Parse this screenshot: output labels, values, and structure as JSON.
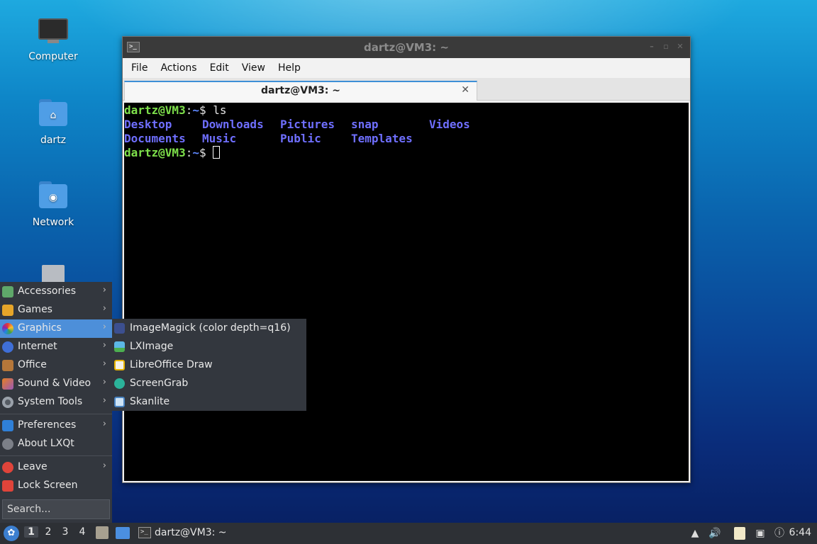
{
  "desktop": {
    "icons": [
      {
        "label": "Computer"
      },
      {
        "label": "dartz"
      },
      {
        "label": "Network"
      }
    ]
  },
  "terminal": {
    "window_title": "dartz@VM3: ~",
    "menu": [
      "File",
      "Actions",
      "Edit",
      "View",
      "Help"
    ],
    "tab_label": "dartz@VM3: ~",
    "prompt_user": "dartz@VM3",
    "prompt_path": "~",
    "prompt_symbol": "$ ",
    "command": "ls",
    "ls_output": [
      "Desktop",
      "Downloads",
      "Pictures",
      "snap",
      "Videos",
      "Documents",
      "Music",
      "Public",
      "Templates"
    ]
  },
  "start_menu": {
    "items": [
      {
        "label": "Accessories",
        "icon": "accessories-icon"
      },
      {
        "label": "Games",
        "icon": "games-icon"
      },
      {
        "label": "Graphics",
        "icon": "graphics-icon"
      },
      {
        "label": "Internet",
        "icon": "internet-icon"
      },
      {
        "label": "Office",
        "icon": "office-icon"
      },
      {
        "label": "Sound & Video",
        "icon": "sound-video-icon"
      },
      {
        "label": "System Tools",
        "icon": "system-tools-icon"
      },
      {
        "label": "Preferences",
        "icon": "preferences-icon"
      },
      {
        "label": "About LXQt",
        "icon": "info-icon"
      },
      {
        "label": "Leave",
        "icon": "power-icon"
      },
      {
        "label": "Lock Screen",
        "icon": "lock-icon"
      }
    ],
    "search_placeholder": "Search...",
    "graphics_submenu": [
      {
        "label": "ImageMagick (color depth=q16)",
        "icon": "imagemagick-icon"
      },
      {
        "label": "LXImage",
        "icon": "lximage-icon"
      },
      {
        "label": "LibreOffice Draw",
        "icon": "libreoffice-draw-icon"
      },
      {
        "label": "ScreenGrab",
        "icon": "screengrab-icon"
      },
      {
        "label": "Skanlite",
        "icon": "skanlite-icon"
      }
    ]
  },
  "taskbar": {
    "desktops": [
      "1",
      "2",
      "3",
      "4"
    ],
    "task_label": "dartz@VM3: ~",
    "clock": "6:44"
  },
  "colors": {
    "menu_highlight": "#4d8fd9",
    "prompt_green": "#7ee04b",
    "directory_blue": "#6f6fff"
  }
}
